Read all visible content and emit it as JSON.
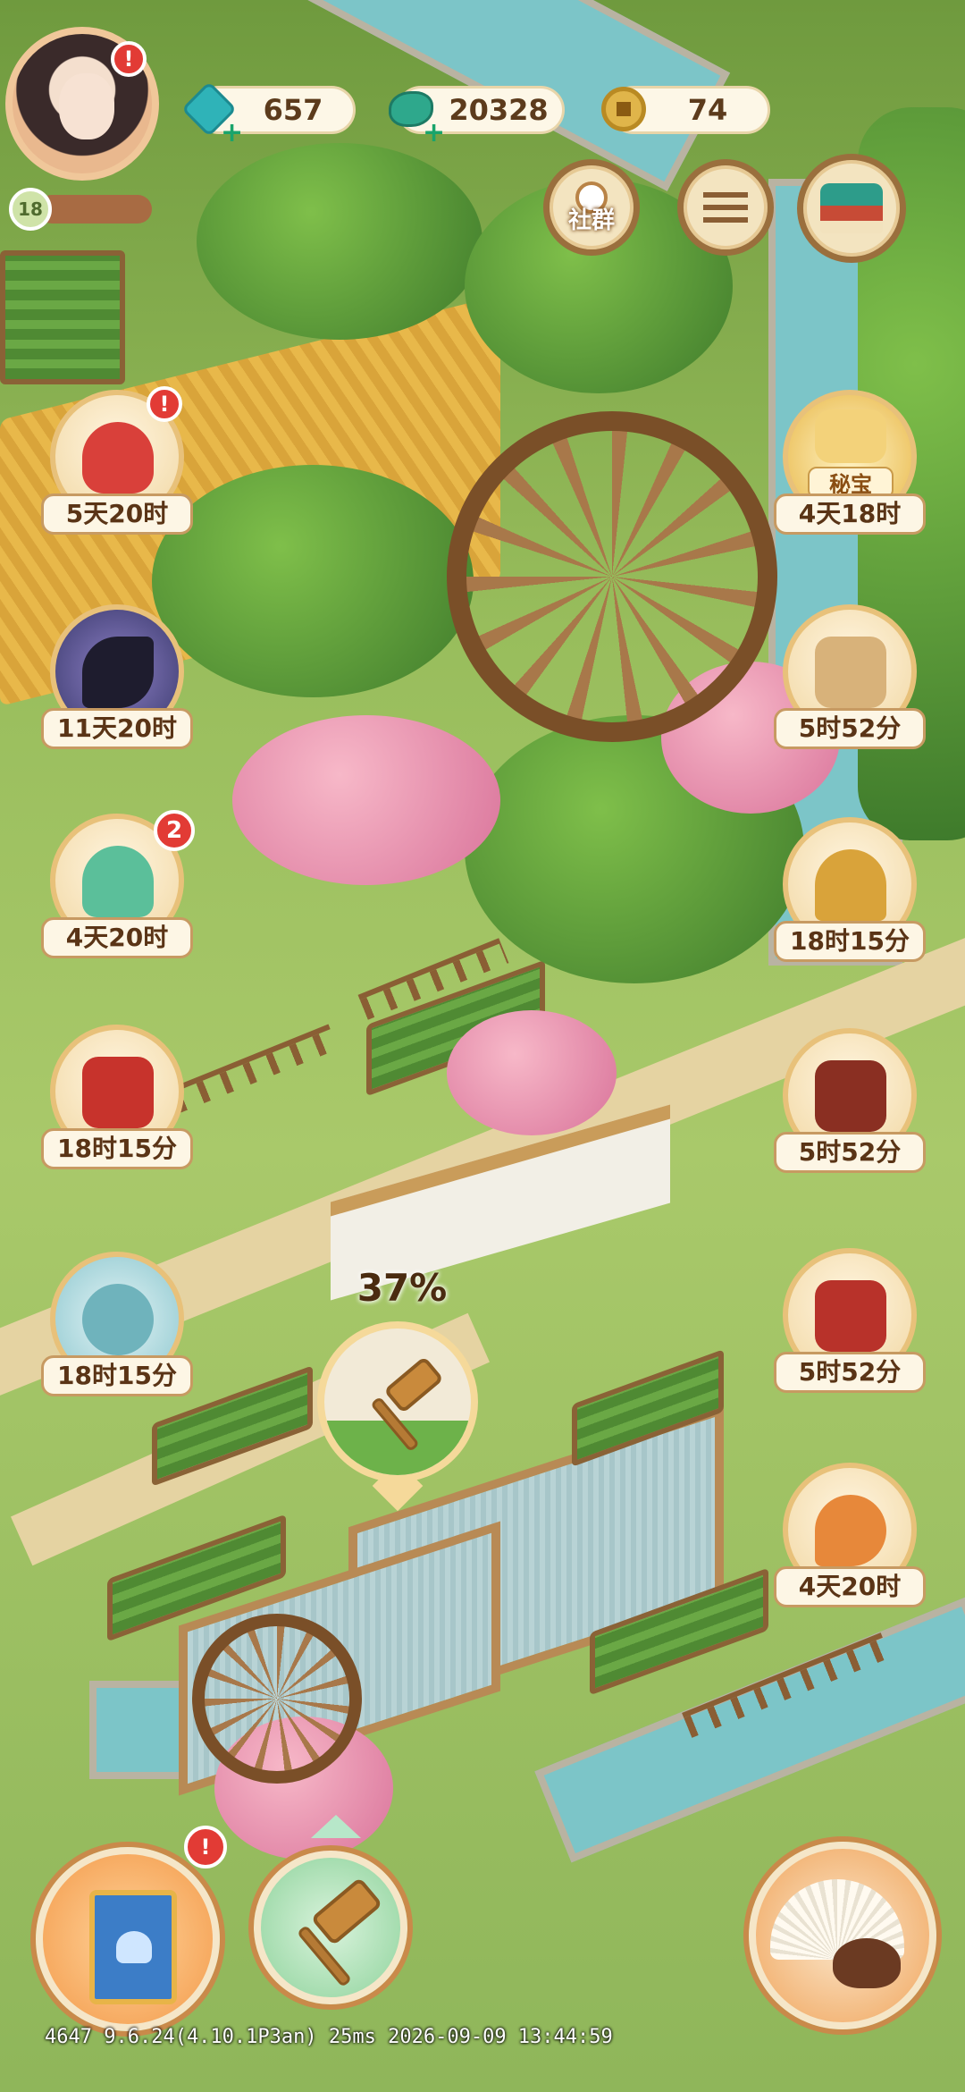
{
  "player": {
    "level": "18",
    "avatar_alert": "!"
  },
  "resources": {
    "gems": "657",
    "jade": "20328",
    "coins": "74"
  },
  "top_buttons": {
    "social_label": "社群"
  },
  "left_events": [
    {
      "timer": "5天20时",
      "badge": "!",
      "icon": "fortune-bag-icon",
      "color": "#d9403a"
    },
    {
      "timer": "11天20时",
      "icon": "magpie-icon",
      "color": "#3b3a6e"
    },
    {
      "timer": "4天20时",
      "badge": "2",
      "icon": "jade-lotus-icon",
      "color": "#5bbf9a"
    },
    {
      "timer": "18时15分",
      "icon": "rabbit-gift-icon",
      "color": "#c7332c"
    },
    {
      "timer": "18时15分",
      "icon": "jade-well-icon",
      "color": "#8fc8cf"
    }
  ],
  "right_events": [
    {
      "timer": "4天18时",
      "tag": "秘宝",
      "icon": "treasure-icon",
      "color": "#e8b84a"
    },
    {
      "timer": "5时52分",
      "icon": "mystery-cards-icon",
      "color": "#d8b27a"
    },
    {
      "timer": "18时15分",
      "icon": "pagoda-icon",
      "color": "#d9a33a"
    },
    {
      "timer": "5时52分",
      "icon": "treasure-chest-icon",
      "color": "#8a2f22"
    },
    {
      "timer": "5时52分",
      "icon": "gift-box-icon",
      "color": "#b8322a"
    },
    {
      "timer": "4天20时",
      "icon": "golden-flame-icon",
      "color": "#e7883a"
    }
  ],
  "build_progress": {
    "percent_text": "37%",
    "percent": 0.37
  },
  "bottom": {
    "book_alert": "!"
  },
  "debug_line": "4647 9.6.24(4.10.1P3an) 25ms 2026-09-09 13:44:59"
}
